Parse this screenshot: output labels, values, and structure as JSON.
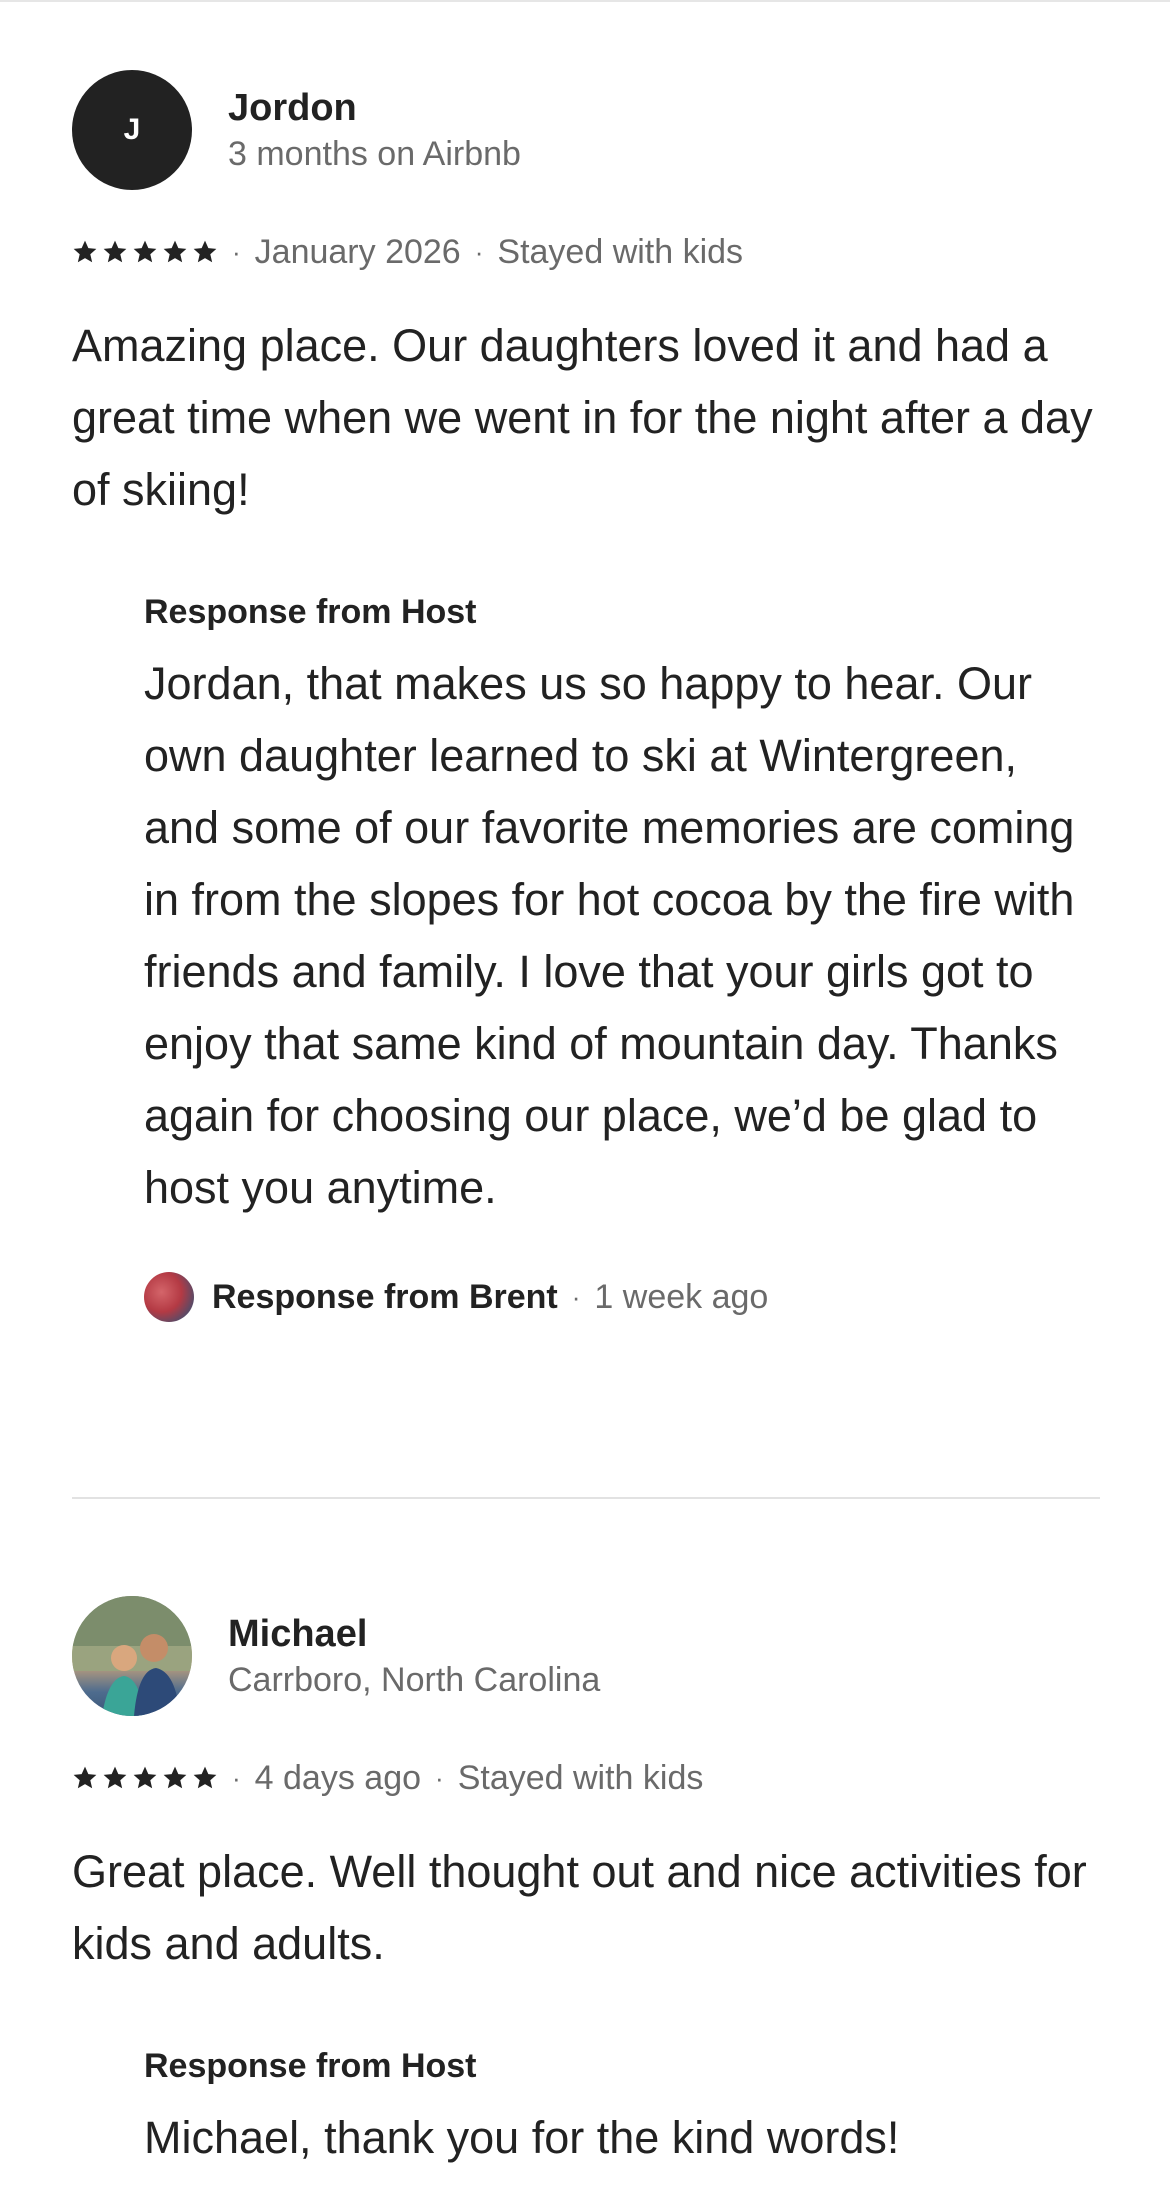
{
  "reviews": [
    {
      "avatar_initial": "J",
      "name": "Jordon",
      "subtitle": "3 months on Airbnb",
      "rating": 5,
      "date": "January 2026",
      "trip_type": "Stayed with kids",
      "text": "Amazing place. Our daughters loved it and had a great time when we went in for the night after a day of skiing!",
      "host_response": {
        "heading": "Response from Host",
        "text": "Jordan, that makes us so happy to hear. Our own daughter learned to ski at Wintergreen, and some of our favorite memories are coming in from the slopes for hot cocoa by the fire with friends and family. I love that your girls got to enjoy that same kind of mountain day. Thanks again for choosing our place, we’d be glad to host you anytime.",
        "responder": "Response from Brent",
        "time": "1 week ago"
      }
    },
    {
      "name": "Michael",
      "subtitle": "Carrboro, North Carolina",
      "rating": 5,
      "date": "4 days ago",
      "trip_type": "Stayed with kids",
      "text": "Great place. Well thought out and nice activities for kids and adults.",
      "host_response": {
        "heading": "Response from Host",
        "text": "Michael, thank you for the kind words!"
      }
    }
  ],
  "separator": "·",
  "star_icon": "star-icon"
}
